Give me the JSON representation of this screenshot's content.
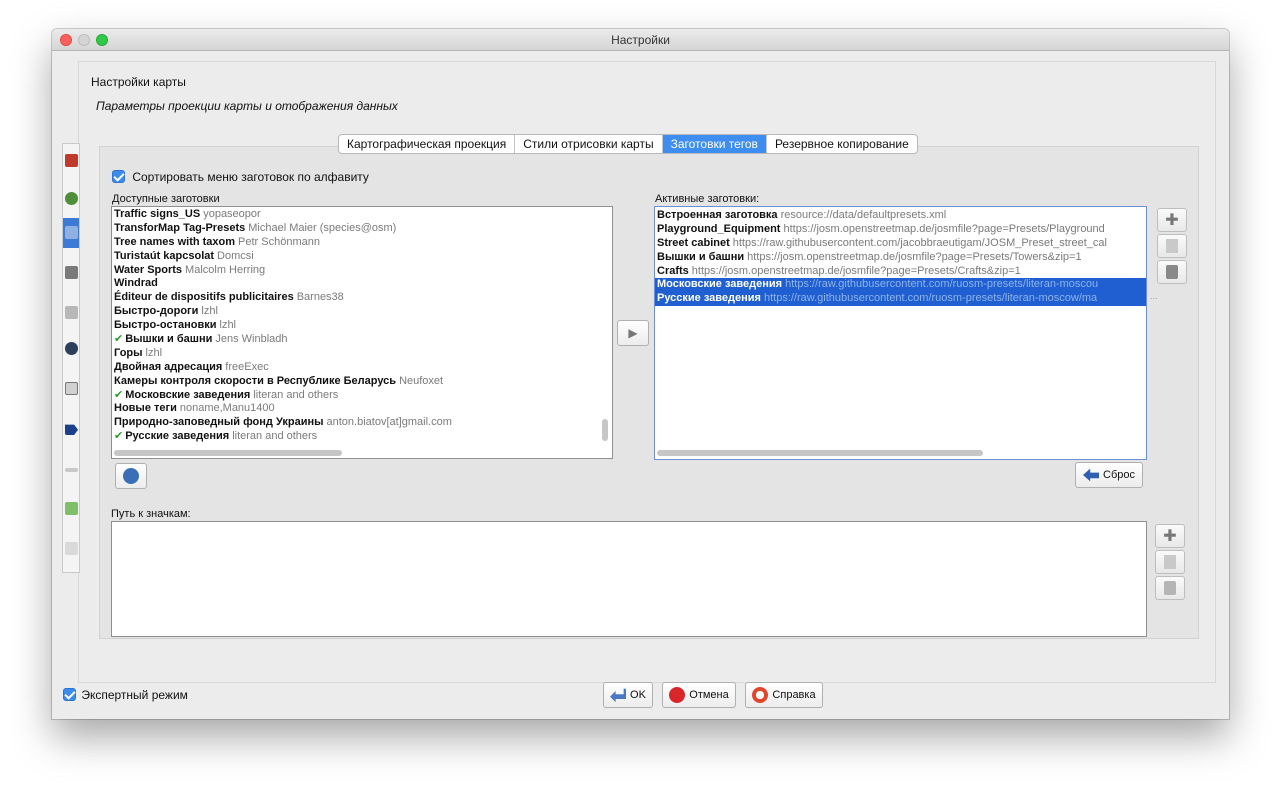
{
  "window": {
    "title": "Настройки"
  },
  "header": {
    "title": "Настройки карты",
    "subtitle": "Параметры проекции карты и отображения данных"
  },
  "tabs": [
    {
      "label": "Картографическая проекция",
      "active": false
    },
    {
      "label": "Стили отрисовки карты",
      "active": false
    },
    {
      "label": "Заготовки тегов",
      "active": true
    },
    {
      "label": "Резервное копирование",
      "active": false
    }
  ],
  "sort_checkbox": {
    "label": "Сортировать меню заготовок по алфавиту",
    "checked": true
  },
  "available": {
    "label": "Доступные заготовки",
    "items": [
      {
        "name": "Traffic signs_US",
        "meta": "yopaseopor",
        "active": false
      },
      {
        "name": "TransforMap Tag-Presets",
        "meta": "Michael Maier (species@osm)",
        "active": false
      },
      {
        "name": "Tree names with taxom",
        "meta": "Petr Schönmann",
        "active": false
      },
      {
        "name": "Turistaút kapcsolat",
        "meta": "Domcsi",
        "active": false
      },
      {
        "name": "Water Sports",
        "meta": "Malcolm Herring",
        "active": false
      },
      {
        "name": "Windrad",
        "meta": "",
        "active": false
      },
      {
        "name": "Éditeur de dispositifs publicitaires",
        "meta": "Barnes38",
        "active": false
      },
      {
        "name": "Быстро-дороги",
        "meta": "lzhl",
        "active": false
      },
      {
        "name": "Быстро-остановки",
        "meta": "lzhl",
        "active": false
      },
      {
        "name": "Вышки и башни",
        "meta": "Jens Winbladh",
        "active": true
      },
      {
        "name": "Горы",
        "meta": "lzhl",
        "active": false
      },
      {
        "name": "Двойная адресация",
        "meta": "freeExec",
        "active": false
      },
      {
        "name": "Камеры контроля скорости в Республике Беларусь",
        "meta": "Neufoxet",
        "active": false
      },
      {
        "name": "Московские заведения",
        "meta": "literan and others",
        "active": true
      },
      {
        "name": "Новые теги",
        "meta": "noname,Manu1400",
        "active": false
      },
      {
        "name": "Природно-заповедный фонд Украины",
        "meta": "anton.biatov[at]gmail.com",
        "active": false
      },
      {
        "name": "Русские заведения",
        "meta": "literan and others",
        "active": true
      }
    ]
  },
  "active": {
    "label": "Активные заготовки:",
    "items": [
      {
        "name": "Встроенная заготовка",
        "meta": "resource://data/defaultpresets.xml",
        "selected": false
      },
      {
        "name": "Playground_Equipment",
        "meta": "https://josm.openstreetmap.de/josmfile?page=Presets/Playground",
        "selected": false
      },
      {
        "name": "Street cabinet",
        "meta": "https://raw.githubusercontent.com/jacobbraeutigam/JOSM_Preset_street_cal",
        "selected": false
      },
      {
        "name": "Вышки и башни",
        "meta": "https://josm.openstreetmap.de/josmfile?page=Presets/Towers&zip=1",
        "selected": false
      },
      {
        "name": "Crafts",
        "meta": "https://josm.openstreetmap.de/josmfile?page=Presets/Crafts&zip=1",
        "selected": false
      },
      {
        "name": "Московские заведения",
        "meta": "https://raw.githubusercontent.com/ruosm-presets/literan-moscou",
        "selected": true
      },
      {
        "name": "Русские заведения",
        "meta": "https://raw.githubusercontent.com/ruosm-presets/literan-moscow/ma",
        "selected": true
      }
    ]
  },
  "ellipsis": "...",
  "reset_button": {
    "label": "Сброс"
  },
  "icon_paths": {
    "label": "Путь к значкам:"
  },
  "expert_mode": {
    "label": "Экспертный режим",
    "checked": true
  },
  "footer": {
    "ok": "OK",
    "cancel": "Отмена",
    "help": "Справка"
  }
}
